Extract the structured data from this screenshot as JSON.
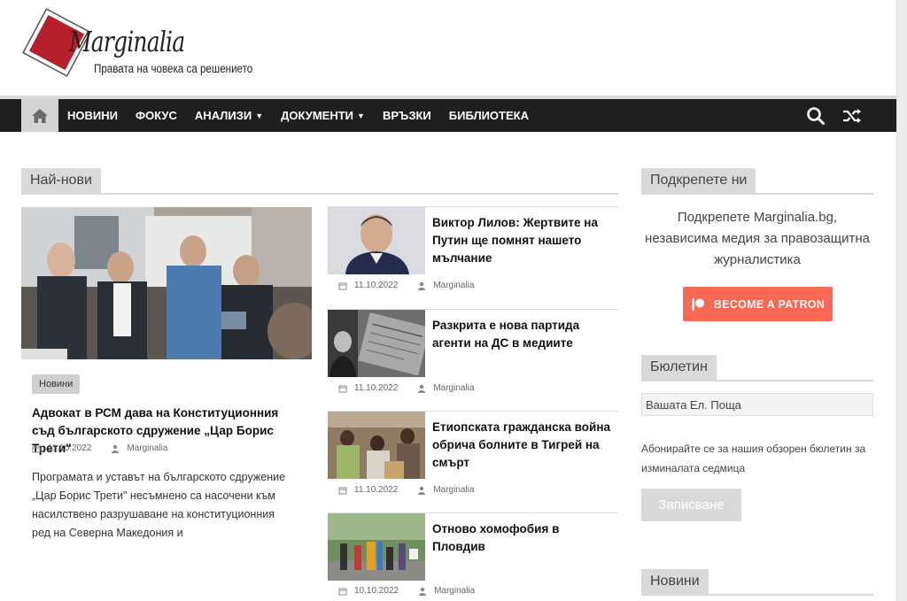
{
  "header": {
    "logo_name": "Marginalia",
    "tagline": "Правата на човека са решението"
  },
  "nav": {
    "home_icon": "home-icon",
    "items": [
      {
        "label": "НОВИНИ",
        "has_dropdown": false
      },
      {
        "label": "ФОКУС",
        "has_dropdown": false
      },
      {
        "label": "АНАЛИЗИ",
        "has_dropdown": true
      },
      {
        "label": "ДОКУМЕНТИ",
        "has_dropdown": true
      },
      {
        "label": "ВРЪЗКИ",
        "has_dropdown": false
      },
      {
        "label": "БИБЛИОТЕКА",
        "has_dropdown": false
      }
    ],
    "search_icon": "search-icon",
    "random_icon": "shuffle-icon"
  },
  "latest": {
    "heading": "Най-нови",
    "featured": {
      "category": "Новини",
      "title": "Адвокат в РСМ дава на Конституционния съд българското сдружение „Цар Борис Трети\"",
      "date": "11.10.2022",
      "author": "Marginalia",
      "excerpt": "Програмата и уставът на българското сдружение „Цар Борис Трети\" несъмнено са насочени към насилствено разрушаване на конституционния ред на Северна Македония и"
    },
    "items": [
      {
        "title": "Виктор Лилов: Жертвите на Путин ще помнят нашето мълчание",
        "date": "11.10.2022",
        "author": "Marginalia"
      },
      {
        "title": "Разкрита е нова партида агенти на ДС в медиите",
        "date": "11.10.2022",
        "author": "Marginalia"
      },
      {
        "title": "Етиопската гражданска война обрича болните в Тигрей на смърт",
        "date": "11.10.2022",
        "author": "Marginalia"
      },
      {
        "title": "Отново хомофобия в Пловдив",
        "date": "10.10.2022",
        "author": "Marginalia"
      }
    ]
  },
  "sidebar": {
    "support": {
      "heading": "Подкрепете ни",
      "text": "Подкрепете Marginalia.bg, независима медия за правозащитна журналистика",
      "button": "BECOME A PATRON"
    },
    "newsletter": {
      "heading": "Бюлетин",
      "placeholder": "Вашата Ел. Поща",
      "description": "Абонирайте се за нашия обзорен бюлетин за изминалата седмица",
      "button": "Записване"
    },
    "news": {
      "heading": "Новини"
    }
  },
  "colors": {
    "nav_bg": "#1f1f1f",
    "accent_red": "#b5202a",
    "patreon": "#f96854",
    "heading_bg": "#d9d9d9"
  }
}
